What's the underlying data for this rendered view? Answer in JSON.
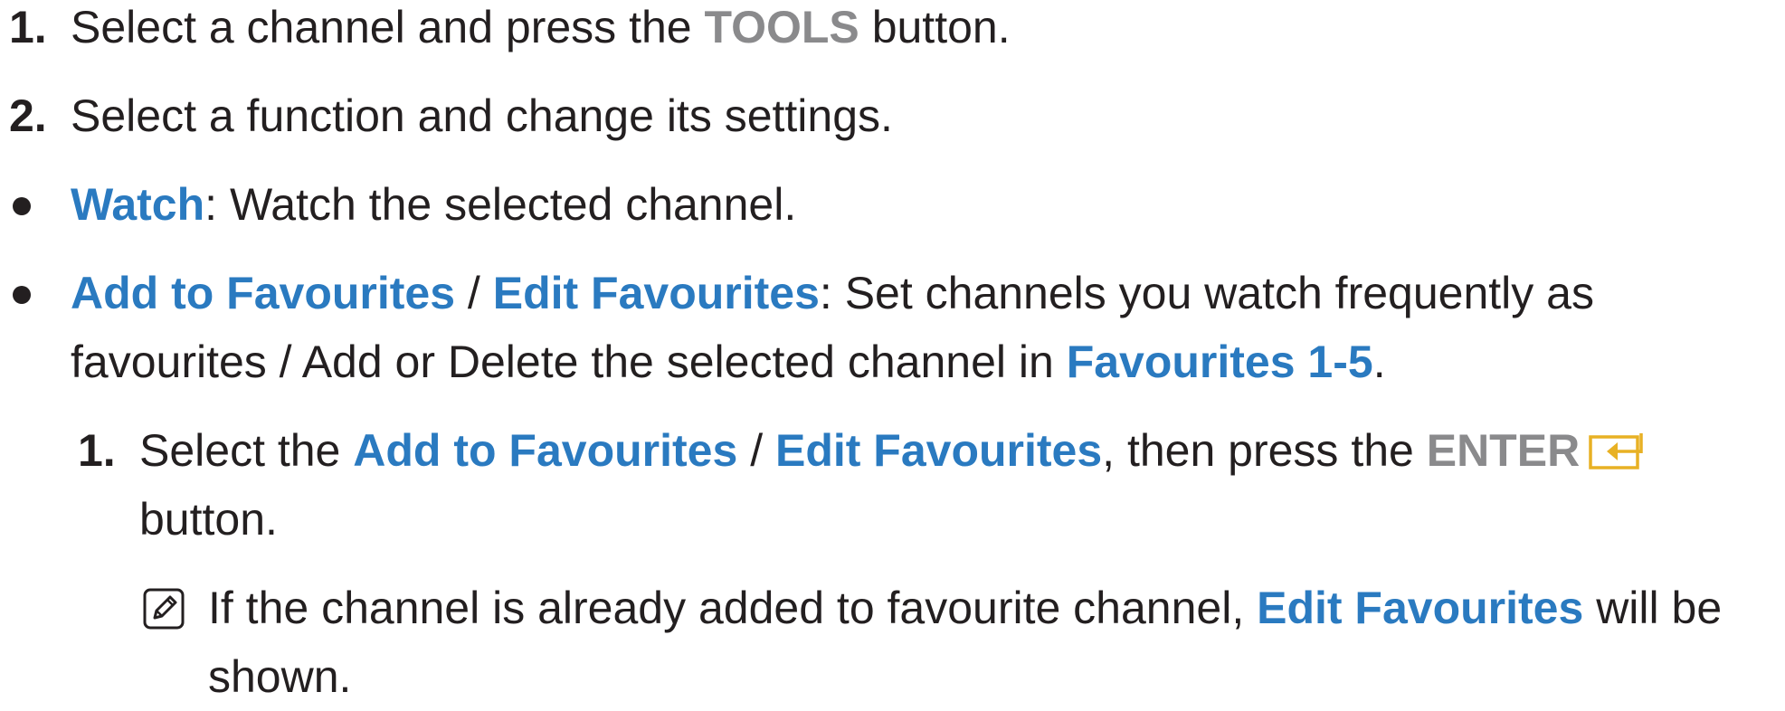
{
  "colors": {
    "text": "#231f20",
    "highlight": "#2a7ac0",
    "key": "#8a8a8c",
    "enter_icon": "#e8b124"
  },
  "step1": {
    "number": "1.",
    "text_before": "Select a channel and press the ",
    "key": "TOOLS",
    "text_after": " button."
  },
  "step2": {
    "number": "2.",
    "text": "Select a function and change its settings."
  },
  "bullet_watch": {
    "label": "Watch",
    "text": ": Watch the selected channel."
  },
  "bullet_favourites": {
    "label_add": "Add to Favourites",
    "separator": " / ",
    "label_edit": "Edit Favourites",
    "text_line1": ": Set channels you watch frequently as",
    "text_line2": "favourites / Add or Delete the selected channel in ",
    "label_fav15": "Favourites 1-5",
    "period": "."
  },
  "substep1": {
    "number": "1.",
    "text_before": "Select the ",
    "label_add": "Add to Favourites",
    "separator": " / ",
    "label_edit": "Edit Favourites",
    "text_middle": ", then press the ",
    "key": "ENTER",
    "text_line2": "button."
  },
  "note": {
    "icon": "note-pencil-icon",
    "text_before": "If the channel is already added to favourite channel, ",
    "label_edit": "Edit Favourites",
    "text_after": " will be",
    "text_line2": "shown."
  }
}
